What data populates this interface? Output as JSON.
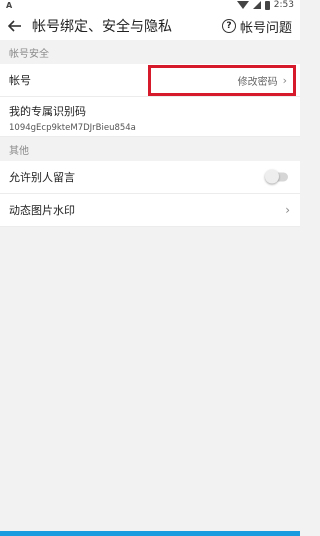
{
  "status": {
    "left_icon": "A",
    "time": "2:53"
  },
  "header": {
    "back_icon": "arrow-left",
    "title": "帐号绑定、安全与隐私",
    "help_icon": "?",
    "help_label": "帐号问题"
  },
  "sections": {
    "security": {
      "header": "帐号安全",
      "account_label": "帐号",
      "change_password": "修改密码",
      "id_label": "我的专属识别码",
      "id_value": "1094gEcp9kteM7DJrBieu854a"
    },
    "other": {
      "header": "其他",
      "allow_comments_label": "允许别人留言",
      "allow_comments_on": false,
      "watermark_label": "动态图片水印"
    }
  },
  "colors": {
    "highlight": "#d61a2b",
    "accent": "#1a9be0"
  }
}
